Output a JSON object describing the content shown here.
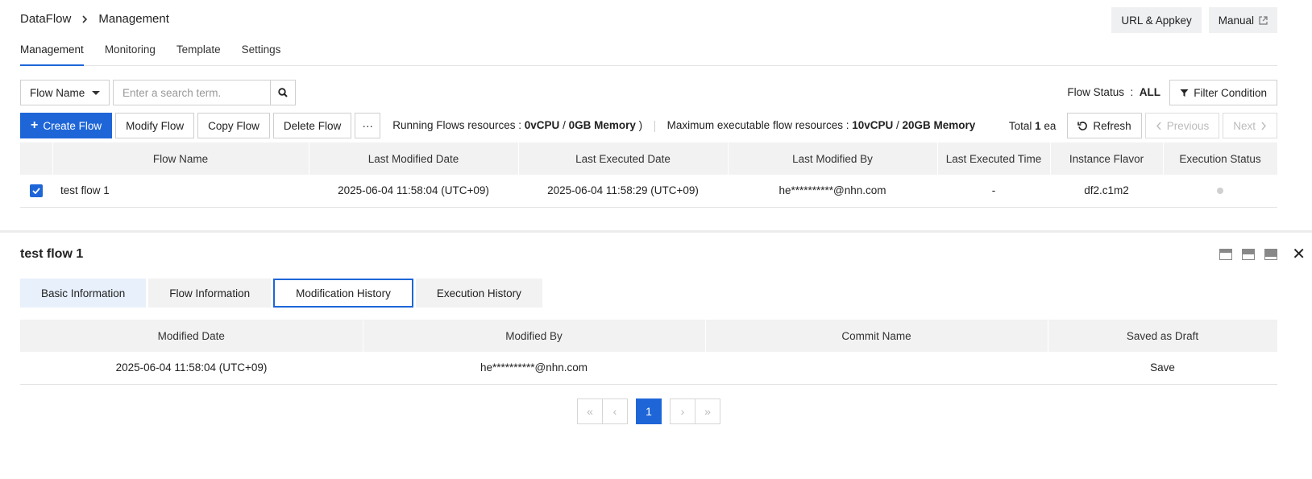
{
  "breadcrumb": {
    "root": "DataFlow",
    "current": "Management"
  },
  "header_buttons": {
    "url_appkey": "URL & Appkey",
    "manual": "Manual"
  },
  "main_tabs": [
    "Management",
    "Monitoring",
    "Template",
    "Settings"
  ],
  "search": {
    "field_select": "Flow Name",
    "placeholder": "Enter a search term.",
    "flow_status_label": "Flow Status",
    "flow_status_sep": ":",
    "flow_status_value": "ALL",
    "filter_label": "Filter Condition"
  },
  "toolbar": {
    "create": "Create Flow",
    "modify": "Modify Flow",
    "copy": "Copy Flow",
    "delete": "Delete Flow",
    "more": "···",
    "running_label": "Running Flows resources : ",
    "running_cpu": "0vCPU",
    "running_slash": " / ",
    "running_mem": "0GB Memory",
    "running_close": " )",
    "max_label": "Maximum executable flow resources : ",
    "max_cpu": "10vCPU",
    "max_slash": " / ",
    "max_mem": "20GB Memory",
    "total_prefix": "Total ",
    "total_count": "1",
    "total_suffix": " ea",
    "refresh": "Refresh",
    "previous": "Previous",
    "next": "Next"
  },
  "flow_table": {
    "columns": [
      "Flow Name",
      "Last Modified Date",
      "Last Executed Date",
      "Last Modified By",
      "Last Executed Time",
      "Instance Flavor",
      "Execution Status"
    ],
    "rows": [
      {
        "name": "test flow 1",
        "last_modified_date": "2025-06-04 11:58:04 (UTC+09)",
        "last_executed_date": "2025-06-04 11:58:29 (UTC+09)",
        "last_modified_by": "he**********@nhn.com",
        "last_executed_time": "-",
        "instance_flavor": "df2.c1m2",
        "checked": true
      }
    ]
  },
  "detail": {
    "title": "test flow 1",
    "tabs": [
      "Basic Information",
      "Flow Information",
      "Modification History",
      "Execution History"
    ],
    "active_tab": "Modification History",
    "history_columns": [
      "Modified Date",
      "Modified By",
      "Commit Name",
      "Saved as Draft"
    ],
    "history_rows": [
      {
        "modified_date": "2025-06-04 11:58:04 (UTC+09)",
        "modified_by": "he**********@nhn.com",
        "commit_name": "",
        "saved_as_draft": "Save"
      }
    ],
    "pagination": {
      "current_page": "1"
    }
  },
  "colors": {
    "accent": "#1e66d8",
    "header_bg": "#f2f2f2",
    "first_tab_bg": "#e7f0fb"
  }
}
